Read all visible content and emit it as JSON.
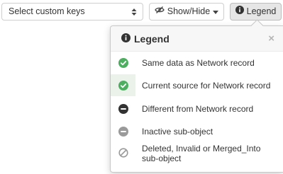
{
  "toolbar": {
    "select_value": "Select custom keys",
    "showhide_label": "Show/Hide",
    "legend_label": "Legend"
  },
  "legend": {
    "title": "Legend",
    "close": "×",
    "items": [
      {
        "label": "Same data as Network record",
        "icon": "check-circle-green-icon"
      },
      {
        "label": "Current source for Network record",
        "icon": "check-circle-green-icon"
      },
      {
        "label": "Different from Network record",
        "icon": "minus-circle-dark-icon"
      },
      {
        "label": "Inactive sub-object",
        "icon": "minus-circle-gray-icon"
      },
      {
        "label_line1": "Deleted, Invalid or Merged_Into",
        "label_line2": "sub-object",
        "icon": "ban-icon"
      }
    ]
  },
  "colors": {
    "green": "#4caf60",
    "dark": "#333333",
    "gray": "#9a9a9a"
  }
}
